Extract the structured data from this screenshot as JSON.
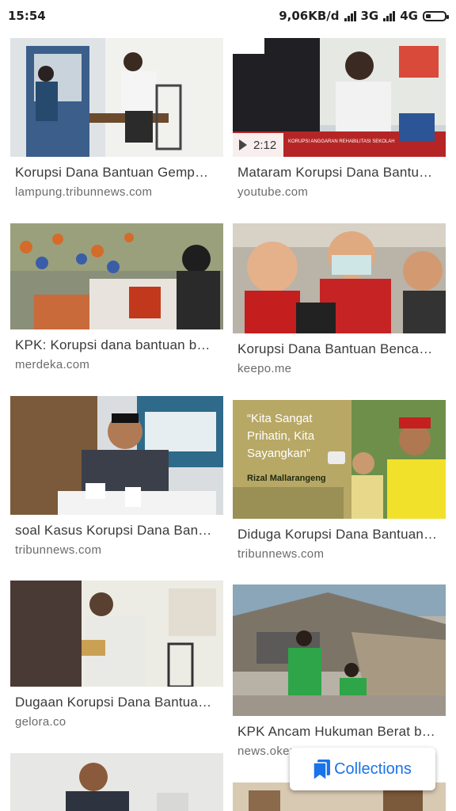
{
  "status_bar": {
    "time": "15:54",
    "speed": "9,06KB/d",
    "network_1": "3G",
    "network_2": "4G"
  },
  "results": [
    {
      "title": "Korupsi Dana Bantuan Gemp…",
      "source": "lampung.tribunnews.com"
    },
    {
      "title": "Mataram Korupsi Dana Bantu…",
      "source": "youtube.com",
      "duration": "2:12"
    },
    {
      "title": "KPK: Korupsi dana bantuan b…",
      "source": "merdeka.com"
    },
    {
      "title": "Korupsi Dana Bantuan Benca…",
      "source": "keepo.me"
    },
    {
      "title": "soal Kasus Korupsi Dana Ban…",
      "source": "tribunnews.com"
    },
    {
      "title": "Diduga Korupsi Dana Bantuan…",
      "source": "tribunnews.com"
    },
    {
      "title": "Dugaan Korupsi Dana Bantua…",
      "source": "gelora.co"
    },
    {
      "title": "KPK Ancam Hukuman Berat b…",
      "source": "news.okezone.com"
    }
  ],
  "thumb_text": {
    "video_caption": "KORUPSI ANGGARAN REHABILITASI SEKOLAH",
    "quote_1": "“Kita Sangat",
    "quote_2": "Prihatin, Kita",
    "quote_3": "Sayangkan”",
    "speaker": "Rizal Mallarangeng"
  },
  "collections_label": "Collections",
  "colors": {
    "accent": "#1a73e8"
  }
}
